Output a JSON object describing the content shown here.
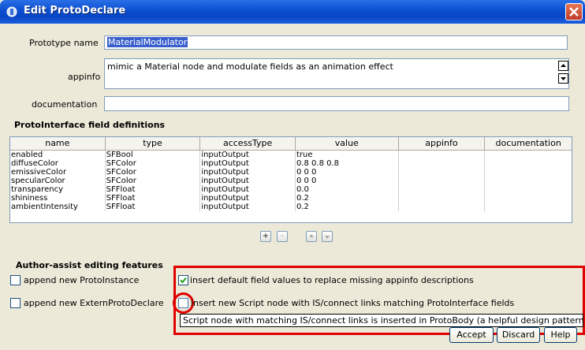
{
  "window": {
    "title": "Edit ProtoDeclare"
  },
  "form": {
    "name_label": "Prototype name",
    "name_value": "MaterialModulator",
    "appinfo_label": "appinfo",
    "appinfo_value": "mimic a Material node and modulate fields as an animation effect",
    "documentation_label": "documentation",
    "documentation_value": ""
  },
  "table": {
    "heading": "ProtoInterface field definitions",
    "columns": [
      "name",
      "type",
      "accessType",
      "value",
      "appinfo",
      "documentation"
    ],
    "rows": [
      [
        "enabled",
        "SFBool",
        "inputOutput",
        "true",
        "",
        ""
      ],
      [
        "diffuseColor",
        "SFColor",
        "inputOutput",
        "0.8 0.8 0.8",
        "",
        ""
      ],
      [
        "emissiveColor",
        "SFColor",
        "inputOutput",
        "0 0 0",
        "",
        ""
      ],
      [
        "specularColor",
        "SFColor",
        "inputOutput",
        "0 0 0",
        "",
        ""
      ],
      [
        "transparency",
        "SFFloat",
        "inputOutput",
        "0.0",
        "",
        ""
      ],
      [
        "shininess",
        "SFFloat",
        "inputOutput",
        "0.2",
        "",
        ""
      ],
      [
        "ambientIntensity",
        "SFFloat",
        "inputOutput",
        "0.2",
        "",
        ""
      ]
    ],
    "add_label": "+",
    "remove_label": "-"
  },
  "assist": {
    "heading": "Author-assist editing features",
    "append_proto_instance": {
      "label": "append new ProtoInstance",
      "checked": false
    },
    "append_extern": {
      "label": "append new ExternProtoDeclare",
      "checked": false
    },
    "insert_defaults": {
      "label": "insert default field values to replace missing appinfo descriptions",
      "checked": true
    },
    "insert_script": {
      "label": "insert new Script node with IS/connect links matching ProtoInterface fields",
      "checked": false
    },
    "tooltip": "Script node with matching IS/connect links is inserted in ProtoBody (a helpful design pattern)"
  },
  "buttons": {
    "accept": "Accept",
    "discard": "Discard",
    "help": "Help"
  },
  "colors": {
    "titlebar": "#0a4fd0",
    "highlight": "#e00000",
    "selection": "#3a5fcd"
  }
}
